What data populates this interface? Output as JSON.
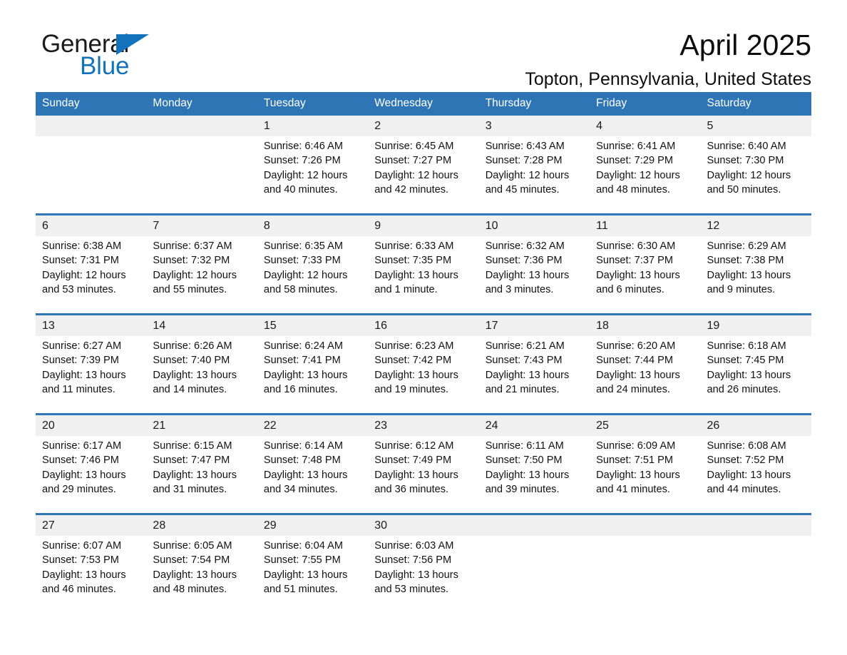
{
  "brand": {
    "name_part1": "General",
    "name_part2": "Blue",
    "triangle_color": "#1273bb"
  },
  "header": {
    "month_title": "April 2025",
    "location": "Topton, Pennsylvania, United States"
  },
  "calendar": {
    "accent_color": "#2e75b6",
    "date_row_bg": "#f0f0f0",
    "weekday_headers": [
      "Sunday",
      "Monday",
      "Tuesday",
      "Wednesday",
      "Thursday",
      "Friday",
      "Saturday"
    ],
    "weeks": [
      {
        "days": [
          {
            "date": "",
            "sunrise": "",
            "sunset": "",
            "daylight_line1": "",
            "daylight_line2": ""
          },
          {
            "date": "",
            "sunrise": "",
            "sunset": "",
            "daylight_line1": "",
            "daylight_line2": ""
          },
          {
            "date": "1",
            "sunrise": "Sunrise: 6:46 AM",
            "sunset": "Sunset: 7:26 PM",
            "daylight_line1": "Daylight: 12 hours",
            "daylight_line2": "and 40 minutes."
          },
          {
            "date": "2",
            "sunrise": "Sunrise: 6:45 AM",
            "sunset": "Sunset: 7:27 PM",
            "daylight_line1": "Daylight: 12 hours",
            "daylight_line2": "and 42 minutes."
          },
          {
            "date": "3",
            "sunrise": "Sunrise: 6:43 AM",
            "sunset": "Sunset: 7:28 PM",
            "daylight_line1": "Daylight: 12 hours",
            "daylight_line2": "and 45 minutes."
          },
          {
            "date": "4",
            "sunrise": "Sunrise: 6:41 AM",
            "sunset": "Sunset: 7:29 PM",
            "daylight_line1": "Daylight: 12 hours",
            "daylight_line2": "and 48 minutes."
          },
          {
            "date": "5",
            "sunrise": "Sunrise: 6:40 AM",
            "sunset": "Sunset: 7:30 PM",
            "daylight_line1": "Daylight: 12 hours",
            "daylight_line2": "and 50 minutes."
          }
        ]
      },
      {
        "days": [
          {
            "date": "6",
            "sunrise": "Sunrise: 6:38 AM",
            "sunset": "Sunset: 7:31 PM",
            "daylight_line1": "Daylight: 12 hours",
            "daylight_line2": "and 53 minutes."
          },
          {
            "date": "7",
            "sunrise": "Sunrise: 6:37 AM",
            "sunset": "Sunset: 7:32 PM",
            "daylight_line1": "Daylight: 12 hours",
            "daylight_line2": "and 55 minutes."
          },
          {
            "date": "8",
            "sunrise": "Sunrise: 6:35 AM",
            "sunset": "Sunset: 7:33 PM",
            "daylight_line1": "Daylight: 12 hours",
            "daylight_line2": "and 58 minutes."
          },
          {
            "date": "9",
            "sunrise": "Sunrise: 6:33 AM",
            "sunset": "Sunset: 7:35 PM",
            "daylight_line1": "Daylight: 13 hours",
            "daylight_line2": "and 1 minute."
          },
          {
            "date": "10",
            "sunrise": "Sunrise: 6:32 AM",
            "sunset": "Sunset: 7:36 PM",
            "daylight_line1": "Daylight: 13 hours",
            "daylight_line2": "and 3 minutes."
          },
          {
            "date": "11",
            "sunrise": "Sunrise: 6:30 AM",
            "sunset": "Sunset: 7:37 PM",
            "daylight_line1": "Daylight: 13 hours",
            "daylight_line2": "and 6 minutes."
          },
          {
            "date": "12",
            "sunrise": "Sunrise: 6:29 AM",
            "sunset": "Sunset: 7:38 PM",
            "daylight_line1": "Daylight: 13 hours",
            "daylight_line2": "and 9 minutes."
          }
        ]
      },
      {
        "days": [
          {
            "date": "13",
            "sunrise": "Sunrise: 6:27 AM",
            "sunset": "Sunset: 7:39 PM",
            "daylight_line1": "Daylight: 13 hours",
            "daylight_line2": "and 11 minutes."
          },
          {
            "date": "14",
            "sunrise": "Sunrise: 6:26 AM",
            "sunset": "Sunset: 7:40 PM",
            "daylight_line1": "Daylight: 13 hours",
            "daylight_line2": "and 14 minutes."
          },
          {
            "date": "15",
            "sunrise": "Sunrise: 6:24 AM",
            "sunset": "Sunset: 7:41 PM",
            "daylight_line1": "Daylight: 13 hours",
            "daylight_line2": "and 16 minutes."
          },
          {
            "date": "16",
            "sunrise": "Sunrise: 6:23 AM",
            "sunset": "Sunset: 7:42 PM",
            "daylight_line1": "Daylight: 13 hours",
            "daylight_line2": "and 19 minutes."
          },
          {
            "date": "17",
            "sunrise": "Sunrise: 6:21 AM",
            "sunset": "Sunset: 7:43 PM",
            "daylight_line1": "Daylight: 13 hours",
            "daylight_line2": "and 21 minutes."
          },
          {
            "date": "18",
            "sunrise": "Sunrise: 6:20 AM",
            "sunset": "Sunset: 7:44 PM",
            "daylight_line1": "Daylight: 13 hours",
            "daylight_line2": "and 24 minutes."
          },
          {
            "date": "19",
            "sunrise": "Sunrise: 6:18 AM",
            "sunset": "Sunset: 7:45 PM",
            "daylight_line1": "Daylight: 13 hours",
            "daylight_line2": "and 26 minutes."
          }
        ]
      },
      {
        "days": [
          {
            "date": "20",
            "sunrise": "Sunrise: 6:17 AM",
            "sunset": "Sunset: 7:46 PM",
            "daylight_line1": "Daylight: 13 hours",
            "daylight_line2": "and 29 minutes."
          },
          {
            "date": "21",
            "sunrise": "Sunrise: 6:15 AM",
            "sunset": "Sunset: 7:47 PM",
            "daylight_line1": "Daylight: 13 hours",
            "daylight_line2": "and 31 minutes."
          },
          {
            "date": "22",
            "sunrise": "Sunrise: 6:14 AM",
            "sunset": "Sunset: 7:48 PM",
            "daylight_line1": "Daylight: 13 hours",
            "daylight_line2": "and 34 minutes."
          },
          {
            "date": "23",
            "sunrise": "Sunrise: 6:12 AM",
            "sunset": "Sunset: 7:49 PM",
            "daylight_line1": "Daylight: 13 hours",
            "daylight_line2": "and 36 minutes."
          },
          {
            "date": "24",
            "sunrise": "Sunrise: 6:11 AM",
            "sunset": "Sunset: 7:50 PM",
            "daylight_line1": "Daylight: 13 hours",
            "daylight_line2": "and 39 minutes."
          },
          {
            "date": "25",
            "sunrise": "Sunrise: 6:09 AM",
            "sunset": "Sunset: 7:51 PM",
            "daylight_line1": "Daylight: 13 hours",
            "daylight_line2": "and 41 minutes."
          },
          {
            "date": "26",
            "sunrise": "Sunrise: 6:08 AM",
            "sunset": "Sunset: 7:52 PM",
            "daylight_line1": "Daylight: 13 hours",
            "daylight_line2": "and 44 minutes."
          }
        ]
      },
      {
        "days": [
          {
            "date": "27",
            "sunrise": "Sunrise: 6:07 AM",
            "sunset": "Sunset: 7:53 PM",
            "daylight_line1": "Daylight: 13 hours",
            "daylight_line2": "and 46 minutes."
          },
          {
            "date": "28",
            "sunrise": "Sunrise: 6:05 AM",
            "sunset": "Sunset: 7:54 PM",
            "daylight_line1": "Daylight: 13 hours",
            "daylight_line2": "and 48 minutes."
          },
          {
            "date": "29",
            "sunrise": "Sunrise: 6:04 AM",
            "sunset": "Sunset: 7:55 PM",
            "daylight_line1": "Daylight: 13 hours",
            "daylight_line2": "and 51 minutes."
          },
          {
            "date": "30",
            "sunrise": "Sunrise: 6:03 AM",
            "sunset": "Sunset: 7:56 PM",
            "daylight_line1": "Daylight: 13 hours",
            "daylight_line2": "and 53 minutes."
          },
          {
            "date": "",
            "sunrise": "",
            "sunset": "",
            "daylight_line1": "",
            "daylight_line2": ""
          },
          {
            "date": "",
            "sunrise": "",
            "sunset": "",
            "daylight_line1": "",
            "daylight_line2": ""
          },
          {
            "date": "",
            "sunrise": "",
            "sunset": "",
            "daylight_line1": "",
            "daylight_line2": ""
          }
        ]
      }
    ]
  }
}
